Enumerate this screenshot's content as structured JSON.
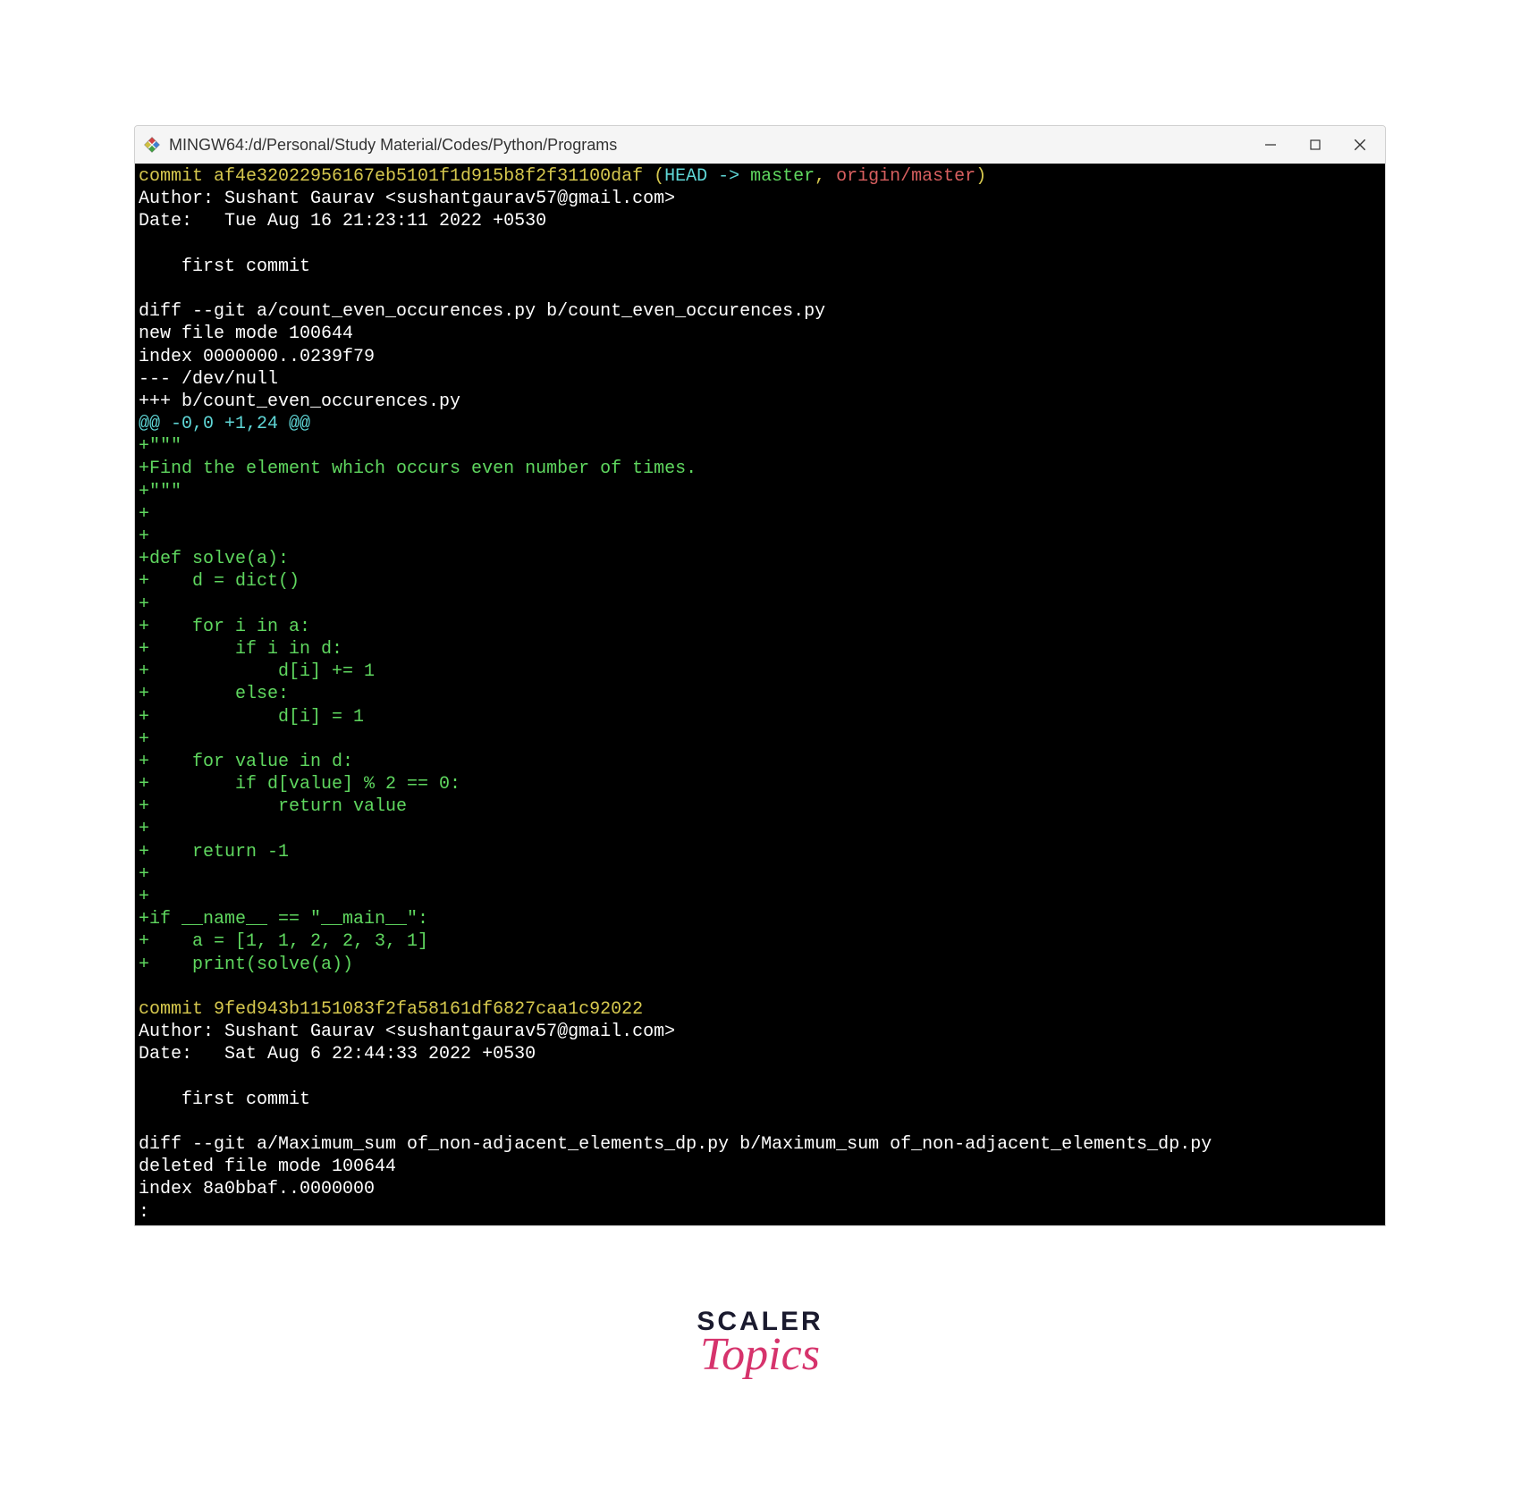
{
  "window": {
    "title": "MINGW64:/d/Personal/Study Material/Codes/Python/Programs"
  },
  "terminal": {
    "commit1": {
      "prefix": "commit af4e32022956167eb5101f1d915b8f2f31100daf (",
      "head": "HEAD -> ",
      "master": "master",
      "sep": ", ",
      "origin": "origin/master",
      "close": ")",
      "author": "Author: Sushant Gaurav <sushantgaurav57@gmail.com>",
      "date": "Date:   Tue Aug 16 21:23:11 2022 +0530",
      "msg": "    first commit"
    },
    "diff1": {
      "line1": "diff --git a/count_even_occurences.py b/count_even_occurences.py",
      "line2": "new file mode 100644",
      "line3": "index 0000000..0239f79",
      "line4": "--- /dev/null",
      "line5": "+++ b/count_even_occurences.py",
      "hunk": "@@ -0,0 +1,24 @@",
      "a01": "+\"\"\"",
      "a02": "+Find the element which occurs even number of times.",
      "a03": "+\"\"\"",
      "a04": "+",
      "a05": "+",
      "a06": "+def solve(a):",
      "a07": "+    d = dict()",
      "a08": "+",
      "a09": "+    for i in a:",
      "a10": "+        if i in d:",
      "a11": "+            d[i] += 1",
      "a12": "+        else:",
      "a13": "+            d[i] = 1",
      "a14": "+",
      "a15": "+    for value in d:",
      "a16": "+        if d[value] % 2 == 0:",
      "a17": "+            return value",
      "a18": "+",
      "a19": "+    return -1",
      "a20": "+",
      "a21": "+",
      "a22": "+if __name__ == \"__main__\":",
      "a23": "+    a = [1, 1, 2, 2, 3, 1]",
      "a24": "+    print(solve(a))"
    },
    "commit2": {
      "line": "commit 9fed943b1151083f2fa58161df6827caa1c92022",
      "author": "Author: Sushant Gaurav <sushantgaurav57@gmail.com>",
      "date": "Date:   Sat Aug 6 22:44:33 2022 +0530",
      "msg": "    first commit"
    },
    "diff2": {
      "line1": "diff --git a/Maximum_sum of_non-adjacent_elements_dp.py b/Maximum_sum of_non-adjacent_elements_dp.py",
      "line2": "deleted file mode 100644",
      "line3": "index 8a0bbaf..0000000",
      "line4": ":"
    }
  },
  "logo": {
    "scaler": "SCALER",
    "topics": "Topics"
  }
}
